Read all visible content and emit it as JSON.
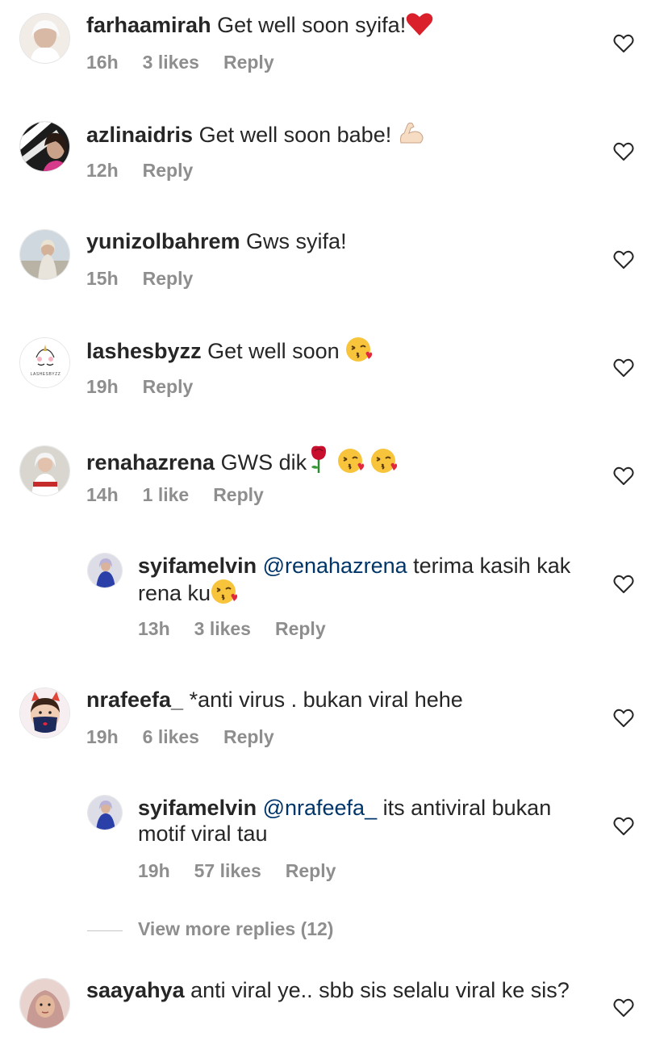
{
  "comments": [
    {
      "username": "farhaamirah",
      "text": "Get well soon syifa!",
      "time": "16h",
      "likes": "3 likes",
      "reply": "Reply"
    },
    {
      "username": "azlinaidris",
      "text": "Get well soon babe!",
      "time": "12h",
      "reply": "Reply"
    },
    {
      "username": "yunizolbahrem",
      "text": "Gws syifa!",
      "time": "15h",
      "reply": "Reply"
    },
    {
      "username": "lashesbyzz",
      "text": "Get well soon",
      "time": "19h",
      "reply": "Reply",
      "avatar_text": "LASHESBYZZ"
    },
    {
      "username": "renahazrena",
      "text": "GWS dik",
      "time": "14h",
      "likes": "1 like",
      "reply": "Reply"
    },
    {
      "username": "syifamelvin",
      "mention": "@renahazrena",
      "text": "terima kasih kak rena ku",
      "time": "13h",
      "likes": "3 likes",
      "reply": "Reply"
    },
    {
      "username": "nrafeefa_",
      "text": "*anti virus . bukan viral hehe",
      "time": "19h",
      "likes": "6 likes",
      "reply": "Reply"
    },
    {
      "username": "syifamelvin",
      "mention": "@nrafeefa_",
      "text": "its antiviral bukan motif viral tau",
      "time": "19h",
      "likes": "57 likes",
      "reply": "Reply"
    },
    {
      "username": "saayahya",
      "text": "anti viral ye.. sbb sis selalu viral ke sis?"
    }
  ],
  "view_more_replies": "View more replies (12)",
  "colors": {
    "text": "#262626",
    "meta": "#8e8e8e",
    "mention": "#003569",
    "divider": "#c7c7c7"
  }
}
